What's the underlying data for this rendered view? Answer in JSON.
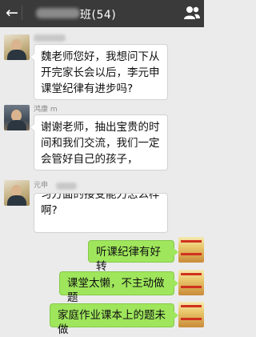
{
  "header": {
    "back_icon": "arrow-left-icon",
    "title": "班(54)",
    "people_icon": "people-icon"
  },
  "messages": [
    {
      "side": "left",
      "sender": "",
      "text": "魏老师您好，我想问下从开完家长会以后，李元申课堂纪律有进步吗?"
    },
    {
      "side": "left",
      "sender": "鸿康 m",
      "text": "谢谢老师，抽出宝贵的时间和我们交流，我们一定会管好自己的孩子，"
    },
    {
      "side": "left",
      "sender": "元申",
      "text_line1": "习方面的接受能力怎么样",
      "text_line2": "啊?"
    },
    {
      "side": "right",
      "text": "听课纪律有好转"
    },
    {
      "side": "right",
      "text": "课堂太懒，不主动做题"
    },
    {
      "side": "right",
      "text": "家庭作业课本上的题未做"
    }
  ]
}
